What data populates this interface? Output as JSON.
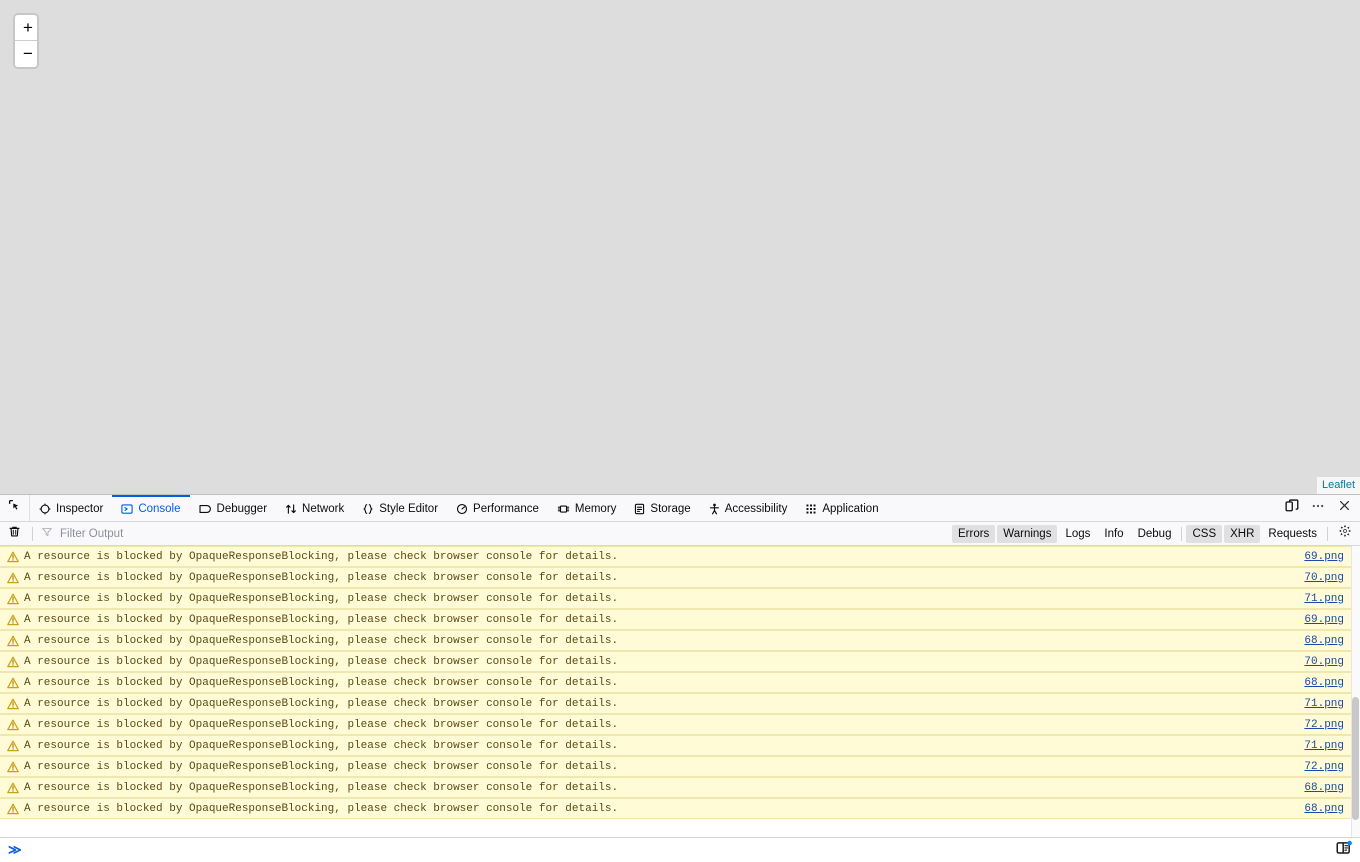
{
  "map": {
    "zoom_in_label": "+",
    "zoom_out_label": "−",
    "attribution": "Leaflet",
    "background_color": "#dddddd"
  },
  "devtools": {
    "picker_icon": "element-picker-icon",
    "tabs": [
      {
        "label": "Inspector",
        "icon": "inspector-icon",
        "active": false
      },
      {
        "label": "Console",
        "icon": "console-icon",
        "active": true
      },
      {
        "label": "Debugger",
        "icon": "debugger-icon",
        "active": false
      },
      {
        "label": "Network",
        "icon": "network-icon",
        "active": false
      },
      {
        "label": "Style Editor",
        "icon": "style-editor-icon",
        "active": false
      },
      {
        "label": "Performance",
        "icon": "performance-icon",
        "active": false
      },
      {
        "label": "Memory",
        "icon": "memory-icon",
        "active": false
      },
      {
        "label": "Storage",
        "icon": "storage-icon",
        "active": false
      },
      {
        "label": "Accessibility",
        "icon": "accessibility-icon",
        "active": false
      },
      {
        "label": "Application",
        "icon": "application-icon",
        "active": false
      }
    ],
    "toolbar_right": [
      {
        "name": "dock-toggle-button",
        "icon": "dock-split-icon"
      },
      {
        "name": "meatball-menu-button",
        "icon": "ellipsis-icon"
      },
      {
        "name": "close-devtools-button",
        "icon": "close-icon"
      }
    ],
    "accent_color": "#0060df"
  },
  "console": {
    "clear_button_icon": "trash-icon",
    "filter": {
      "icon": "funnel-icon",
      "value": "",
      "placeholder": "Filter Output"
    },
    "severity_filters": [
      {
        "label": "Errors",
        "checked": true
      },
      {
        "label": "Warnings",
        "checked": true
      },
      {
        "label": "Logs",
        "checked": false
      },
      {
        "label": "Info",
        "checked": false
      },
      {
        "label": "Debug",
        "checked": false
      }
    ],
    "category_filters": [
      {
        "label": "CSS",
        "checked": true
      },
      {
        "label": "XHR",
        "checked": true
      },
      {
        "label": "Requests",
        "checked": false
      }
    ],
    "settings_button_icon": "gear-icon",
    "message_text": "A resource is blocked by OpaqueResponseBlocking, please check browser console for details.",
    "rows": [
      {
        "level": "warning",
        "message": "A resource is blocked by OpaqueResponseBlocking, please check browser console for details.",
        "frame": "69.png"
      },
      {
        "level": "warning",
        "message": "A resource is blocked by OpaqueResponseBlocking, please check browser console for details.",
        "frame": "70.png"
      },
      {
        "level": "warning",
        "message": "A resource is blocked by OpaqueResponseBlocking, please check browser console for details.",
        "frame": "71.png"
      },
      {
        "level": "warning",
        "message": "A resource is blocked by OpaqueResponseBlocking, please check browser console for details.",
        "frame": "69.png"
      },
      {
        "level": "warning",
        "message": "A resource is blocked by OpaqueResponseBlocking, please check browser console for details.",
        "frame": "68.png"
      },
      {
        "level": "warning",
        "message": "A resource is blocked by OpaqueResponseBlocking, please check browser console for details.",
        "frame": "70.png"
      },
      {
        "level": "warning",
        "message": "A resource is blocked by OpaqueResponseBlocking, please check browser console for details.",
        "frame": "68.png"
      },
      {
        "level": "warning",
        "message": "A resource is blocked by OpaqueResponseBlocking, please check browser console for details.",
        "frame": "71.png"
      },
      {
        "level": "warning",
        "message": "A resource is blocked by OpaqueResponseBlocking, please check browser console for details.",
        "frame": "72.png"
      },
      {
        "level": "warning",
        "message": "A resource is blocked by OpaqueResponseBlocking, please check browser console for details.",
        "frame": "71.png"
      },
      {
        "level": "warning",
        "message": "A resource is blocked by OpaqueResponseBlocking, please check browser console for details.",
        "frame": "72.png"
      },
      {
        "level": "warning",
        "message": "A resource is blocked by OpaqueResponseBlocking, please check browser console for details.",
        "frame": "68.png"
      },
      {
        "level": "warning",
        "message": "A resource is blocked by OpaqueResponseBlocking, please check browser console for details.",
        "frame": "68.png"
      }
    ],
    "input": {
      "prompt": "≫",
      "value": "",
      "placeholder": ""
    },
    "editor_toggle_icon": "editor-mode-icon",
    "warning_row_bg": "#fffbd6",
    "warning_text_color": "#5a4b16",
    "link_color": "#1a4ba8"
  }
}
